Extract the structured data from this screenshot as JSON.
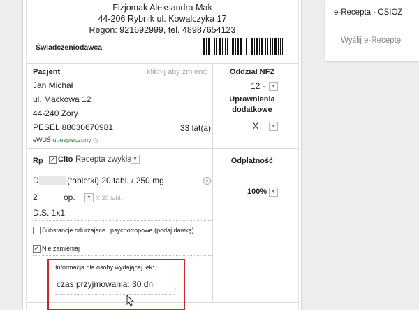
{
  "clinic": {
    "name": "Fizjomak Aleksandra Mak",
    "address": "44-206 Rybnik ul. Kowalczyka 17",
    "regon": "Regon: 921692999, tel. 48987654123"
  },
  "provider_label": "Świadczeniodawca",
  "patient": {
    "label": "Pacjent",
    "hint": "kliknij aby zmienić",
    "name": "Jan Michał",
    "street": "ul. Mackowa 12",
    "city": "44-240 Żory",
    "pesel": "PESEL  88030670981",
    "age": "33 lat(a)",
    "ewus_prefix": "eWUŚ",
    "ewus_status": "ubezpieczony"
  },
  "nfz": {
    "label": "Oddział NFZ",
    "value": "12 -",
    "perm_label_1": "Uprawnienia",
    "perm_label_2": "dodatkowe",
    "perm_value": "X"
  },
  "rp": {
    "label": "Rp",
    "cito_checked": true,
    "cito_label": "Cito",
    "recipe_type": "Recepta zwykła",
    "drug_prefix": "D",
    "drug_desc": "(tabletki) 20 tabl. / 250 mg",
    "qty": "2",
    "unit": "op.",
    "pack": "X 20 tabl.",
    "ds": "D.S. 1x1",
    "narcotics_label": "Substancje odurzające i psychotropowe (podaj dawkę)",
    "no_substitute_label": "Nie zamieniaj",
    "info_label": "Informacja dla osoby wydającej lek:",
    "info_value": "czas przyjmowania: 30 dni"
  },
  "payment": {
    "label": "Odpłatność",
    "value": "100%"
  },
  "side": {
    "title": "e-Recepta - CSIOZ",
    "send": "Wyślij e-Receptę"
  }
}
